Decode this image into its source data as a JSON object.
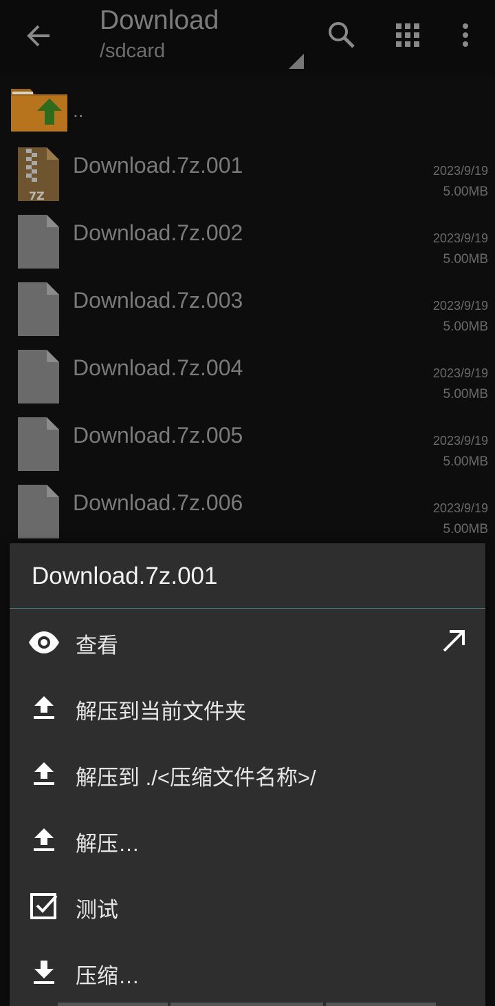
{
  "toolbar": {
    "title": "Download",
    "path": "/sdcard",
    "icons": [
      "back-arrow-icon",
      "search-icon",
      "grid-view-icon",
      "more-vert-icon"
    ]
  },
  "parent_folder": {
    "label": ".."
  },
  "files": [
    {
      "name": "Download.7z.001",
      "date": "2023/9/19",
      "size": "5.00MB",
      "icon": "7z-archive-icon"
    },
    {
      "name": "Download.7z.002",
      "date": "2023/9/19",
      "size": "5.00MB",
      "icon": "file-icon"
    },
    {
      "name": "Download.7z.003",
      "date": "2023/9/19",
      "size": "5.00MB",
      "icon": "file-icon"
    },
    {
      "name": "Download.7z.004",
      "date": "2023/9/19",
      "size": "5.00MB",
      "icon": "file-icon"
    },
    {
      "name": "Download.7z.005",
      "date": "2023/9/19",
      "size": "5.00MB",
      "icon": "file-icon"
    },
    {
      "name": "Download.7z.006",
      "date": "2023/9/19",
      "size": "5.00MB",
      "icon": "file-icon"
    }
  ],
  "context_menu": {
    "title": "Download.7z.001",
    "items": [
      {
        "label": "查看",
        "icon": "eye-icon",
        "extra_icon": "open-external-icon"
      },
      {
        "label": "解压到当前文件夹",
        "icon": "upload-icon"
      },
      {
        "label": "解压到 ./<压缩文件名称>/",
        "icon": "upload-icon"
      },
      {
        "label": "解压…",
        "icon": "upload-icon"
      },
      {
        "label": "测试",
        "icon": "checkbox-icon"
      },
      {
        "label": "压缩…",
        "icon": "download-icon"
      }
    ]
  },
  "colors": {
    "background": "#0d0d0d",
    "menu_background": "#2e2e2e",
    "accent_divider": "#3f7f8a",
    "folder": "#c07a1a"
  }
}
